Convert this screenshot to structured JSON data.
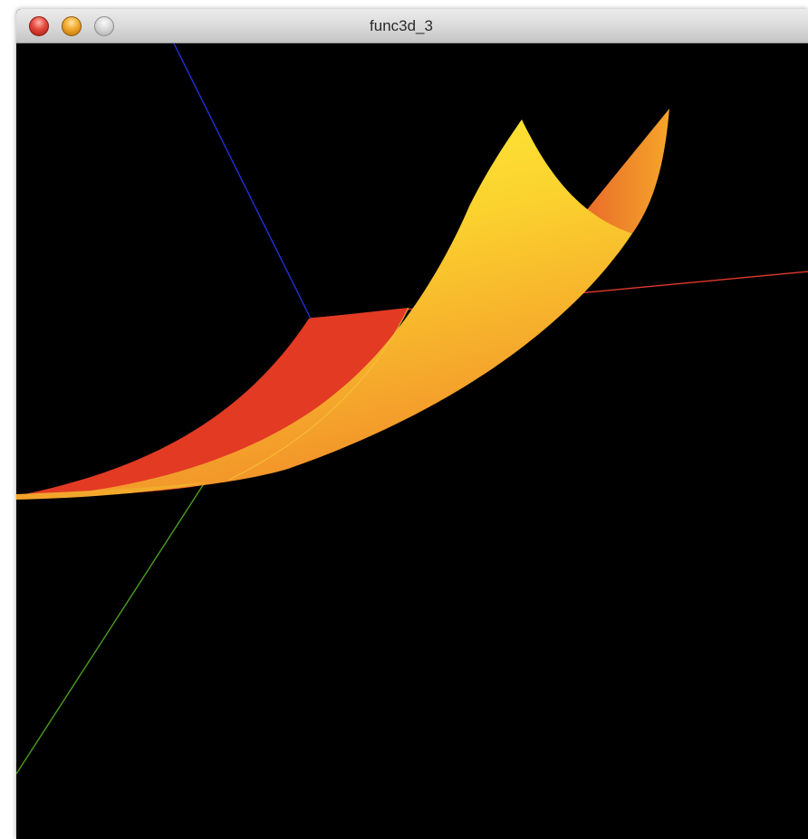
{
  "window": {
    "title": "func3d_3"
  },
  "colors": {
    "axis_x": "#e23a2c",
    "axis_y": "#4a9d1e",
    "axis_z": "#2230d8",
    "surface_red": "#e23a26",
    "surface_yellow": "#fff136",
    "surface_orange": "#f49a25",
    "background": "#000000"
  },
  "icons": {
    "close": "close-icon",
    "minimize": "minimize-icon",
    "zoom": "zoom-icon"
  }
}
